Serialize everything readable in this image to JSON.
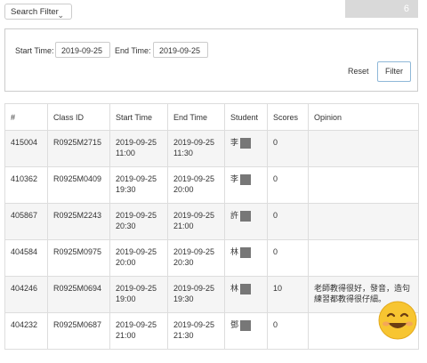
{
  "toolbar": {
    "filter_toggle_label": "Search Filter",
    "count": "6"
  },
  "filter": {
    "start_label": "Start Time:",
    "start_value": "2019-09-25",
    "end_label": "End Time:",
    "end_value": "2019-09-25",
    "reset_label": "Reset",
    "filter_label": "Filter"
  },
  "table": {
    "headers": [
      "#",
      "Class ID",
      "Start Time",
      "End Time",
      "Student",
      "Scores",
      "Opinion"
    ],
    "rows": [
      {
        "id": "415004",
        "class_id": "R0925M2715",
        "start_date": "2019-09-25",
        "start_time": "11:00",
        "end_date": "2019-09-25",
        "end_time": "11:30",
        "student": "李",
        "score": "0",
        "opinion": ""
      },
      {
        "id": "410362",
        "class_id": "R0925M0409",
        "start_date": "2019-09-25",
        "start_time": "19:30",
        "end_date": "2019-09-25",
        "end_time": "20:00",
        "student": "李",
        "score": "0",
        "opinion": ""
      },
      {
        "id": "405867",
        "class_id": "R0925M2243",
        "start_date": "2019-09-25",
        "start_time": "20:30",
        "end_date": "2019-09-25",
        "end_time": "21:00",
        "student": "許",
        "score": "0",
        "opinion": ""
      },
      {
        "id": "404584",
        "class_id": "R0925M0975",
        "start_date": "2019-09-25",
        "start_time": "20:00",
        "end_date": "2019-09-25",
        "end_time": "20:30",
        "student": "林",
        "score": "0",
        "opinion": ""
      },
      {
        "id": "404246",
        "class_id": "R0925M0694",
        "start_date": "2019-09-25",
        "start_time": "19:00",
        "end_date": "2019-09-25",
        "end_time": "19:30",
        "student": "林",
        "score": "10",
        "opinion": "老師教得很好，發音，造句練習都教得很仔細。"
      },
      {
        "id": "404232",
        "class_id": "R0925M0687",
        "start_date": "2019-09-25",
        "start_time": "21:00",
        "end_date": "2019-09-25",
        "end_time": "21:30",
        "student": "鄧",
        "score": "0",
        "opinion": ""
      }
    ]
  },
  "icons": {
    "dropdown": "chevron-down-icon",
    "sticker": "smiling-face-icon"
  }
}
